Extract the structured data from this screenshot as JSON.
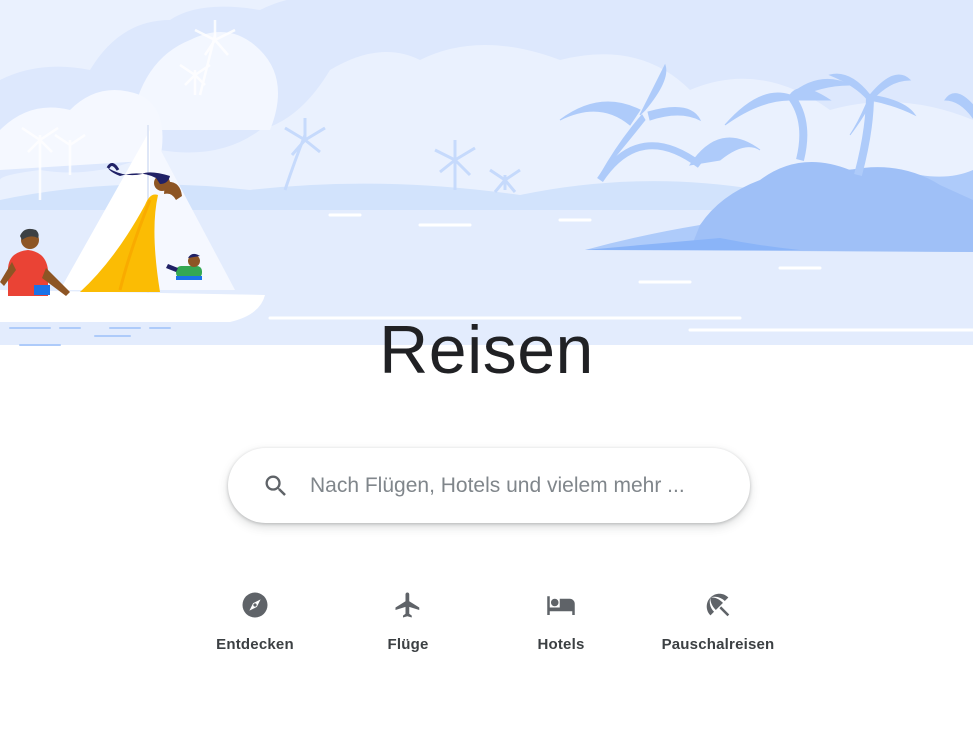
{
  "page": {
    "title": "Reisen"
  },
  "search": {
    "placeholder": "Nach Flügen, Hotels und vielem mehr ...",
    "value": "",
    "icon": "search-icon"
  },
  "nav": {
    "items": [
      {
        "label": "Entdecken",
        "icon": "compass-icon"
      },
      {
        "label": "Flüge",
        "icon": "airplane-icon"
      },
      {
        "label": "Hotels",
        "icon": "bed-icon"
      },
      {
        "label": "Pauschalreisen",
        "icon": "beach-umbrella-icon"
      }
    ]
  },
  "colors": {
    "hero_sky": "#e8efff",
    "hero_light": "#d2e3fc",
    "hero_mid": "#aecbfa",
    "hero_accent": "#8ab4f8",
    "text_primary": "#202124",
    "icon_gray": "#5f6368",
    "nav_label": "#3c4043"
  }
}
